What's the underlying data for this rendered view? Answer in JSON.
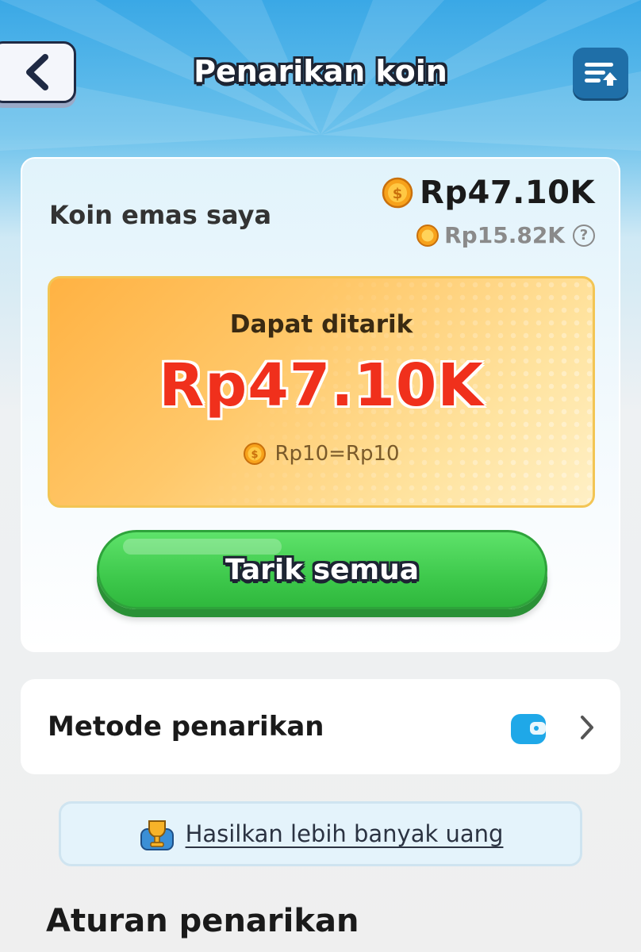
{
  "header": {
    "title": "Penarikan koin"
  },
  "balance": {
    "label": "Koin emas saya",
    "main_amount": "Rp47.10K",
    "sub_amount": "Rp15.82K",
    "help_symbol": "?"
  },
  "withdrawable": {
    "label": "Dapat ditarik",
    "amount": "Rp47.10K",
    "rate": "Rp10=Rp10"
  },
  "actions": {
    "withdraw_all_label": "Tarik semua"
  },
  "method": {
    "label": "Metode penarikan",
    "icon": "wallet-icon"
  },
  "earn_more": {
    "label": "Hasilkan lebih banyak uang"
  },
  "rules": {
    "title": "Aturan penarikan"
  },
  "colors": {
    "header_bg": "#3aa8e6",
    "accent_green": "#3ec94c",
    "amount_red": "#f0301c",
    "panel_orange": "#ffc86a",
    "wallet_blue": "#1fa8e8"
  }
}
